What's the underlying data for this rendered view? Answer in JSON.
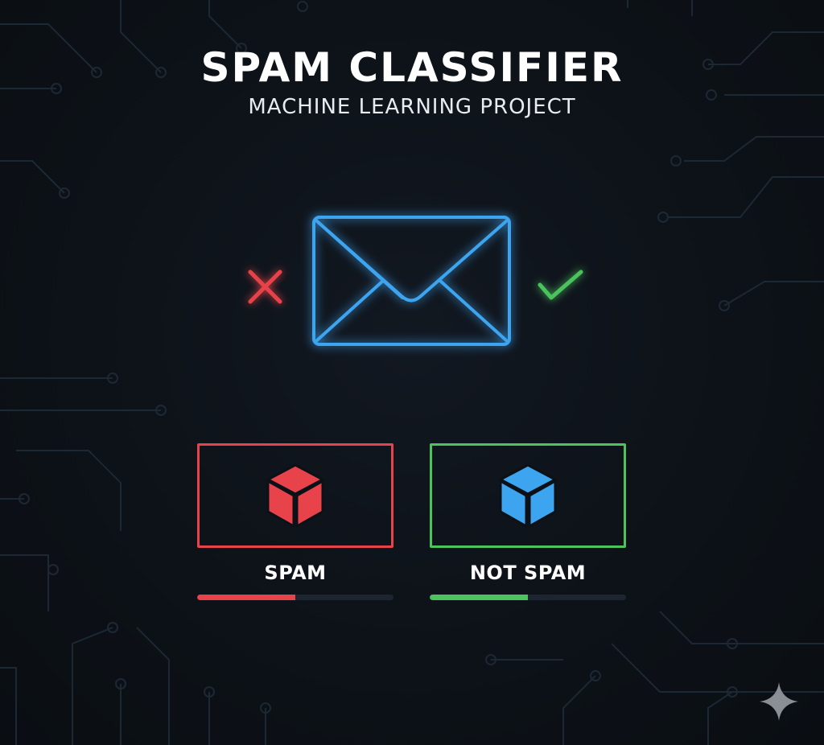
{
  "header": {
    "title": "SPAM CLASSIFIER",
    "subtitle": "MACHINE LEARNING PROJECT"
  },
  "hero": {
    "email_icon": "envelope-icon",
    "reject_icon": "cross-icon",
    "accept_icon": "checkmark-icon"
  },
  "categories": [
    {
      "label": "SPAM",
      "icon": "cube-icon",
      "color": "#e8434a",
      "progress": 0.5
    },
    {
      "label": "NOT SPAM",
      "icon": "cube-icon",
      "color": "#4cc35d",
      "icon_color": "#3da4f0",
      "progress": 0.5
    }
  ],
  "colors": {
    "background": "#0c1117",
    "accent_blue": "#3da4f0",
    "spam_red": "#e8434a",
    "safe_green": "#4cc35d",
    "circuit_lines": "#1f2c38"
  },
  "watermark": {
    "icon": "sparkle-icon"
  }
}
